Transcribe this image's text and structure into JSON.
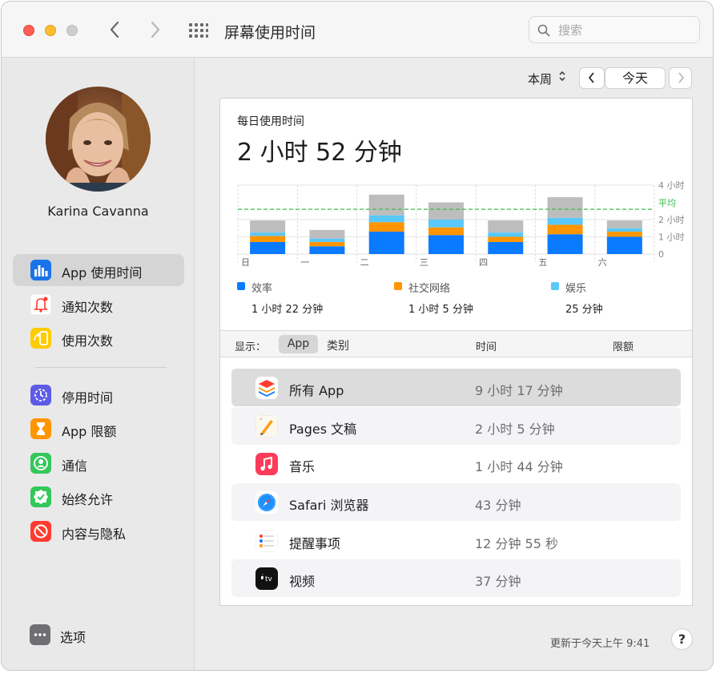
{
  "window": {
    "title": "屏幕使用时间",
    "search_placeholder": "搜索"
  },
  "colors": {
    "close": "#fe5f57",
    "minimize": "#febc2e",
    "zoom": "#cbcbcb",
    "productivity": "#0a7aff",
    "social": "#ff9500",
    "entertainment": "#5ac8fa",
    "other": "#bdbdbd",
    "average_line": "#3dbb4a"
  },
  "user": {
    "name": "Karina Cavanna"
  },
  "sidebar": {
    "items": [
      {
        "label": "App 使用时间",
        "icon": "bar-chart-icon",
        "active": true
      },
      {
        "label": "通知次数",
        "icon": "bell-icon"
      },
      {
        "label": "使用次数",
        "icon": "pickup-icon"
      },
      {
        "label": "停用时间",
        "icon": "downtime-icon"
      },
      {
        "label": "App 限额",
        "icon": "hourglass-icon"
      },
      {
        "label": "通信",
        "icon": "person-icon"
      },
      {
        "label": "始终允许",
        "icon": "check-badge-icon"
      },
      {
        "label": "内容与隐私",
        "icon": "no-entry-icon"
      }
    ],
    "options_label": "选项"
  },
  "toolbar": {
    "period": "本周",
    "today": "今天"
  },
  "summary": {
    "subtitle": "每日使用时间",
    "total": "2 小时 52 分钟",
    "average_label": "平均"
  },
  "chart_data": {
    "type": "bar",
    "stacked": true,
    "categories": [
      "日",
      "一",
      "二",
      "三",
      "四",
      "五",
      "六"
    ],
    "y_ticks": [
      "4 小时",
      "2 小时",
      "1 小时",
      "0"
    ],
    "ylim": [
      0,
      4
    ],
    "average": 2.6,
    "series": [
      {
        "name": "效率",
        "values": [
          0.7,
          0.45,
          1.3,
          1.1,
          0.7,
          1.15,
          1.0
        ]
      },
      {
        "name": "社交网络",
        "values": [
          0.35,
          0.25,
          0.55,
          0.45,
          0.3,
          0.55,
          0.3
        ]
      },
      {
        "name": "娱乐",
        "values": [
          0.2,
          0.2,
          0.4,
          0.45,
          0.25,
          0.4,
          0.2
        ]
      },
      {
        "name": "",
        "values": [
          0.7,
          0.5,
          1.2,
          1.0,
          0.7,
          1.2,
          0.45
        ]
      }
    ]
  },
  "legend": [
    {
      "name": "效率",
      "value": "1 小时 22 分钟"
    },
    {
      "name": "社交网络",
      "value": "1 小时 5 分钟"
    },
    {
      "name": "娱乐",
      "value": "25 分钟"
    }
  ],
  "filter": {
    "show_label": "显示：",
    "app_tab": "App",
    "category_tab": "类别",
    "time_header": "时间",
    "limit_header": "限额"
  },
  "apps": [
    {
      "name": "所有 App",
      "time": "9 小时 17 分钟",
      "icon": "layers-icon"
    },
    {
      "name": "Pages 文稿",
      "time": "2 小时 5 分钟",
      "icon": "pages-icon"
    },
    {
      "name": "音乐",
      "time": "1 小时 44 分钟",
      "icon": "music-icon"
    },
    {
      "name": "Safari 浏览器",
      "time": "43 分钟",
      "icon": "safari-icon"
    },
    {
      "name": "提醒事项",
      "time": "12 分钟 55 秒",
      "icon": "reminders-icon"
    },
    {
      "name": "视频",
      "time": "37 分钟",
      "icon": "tv-icon"
    }
  ],
  "footer": {
    "updated": "更新于今天上午 9:41",
    "help": "?"
  }
}
